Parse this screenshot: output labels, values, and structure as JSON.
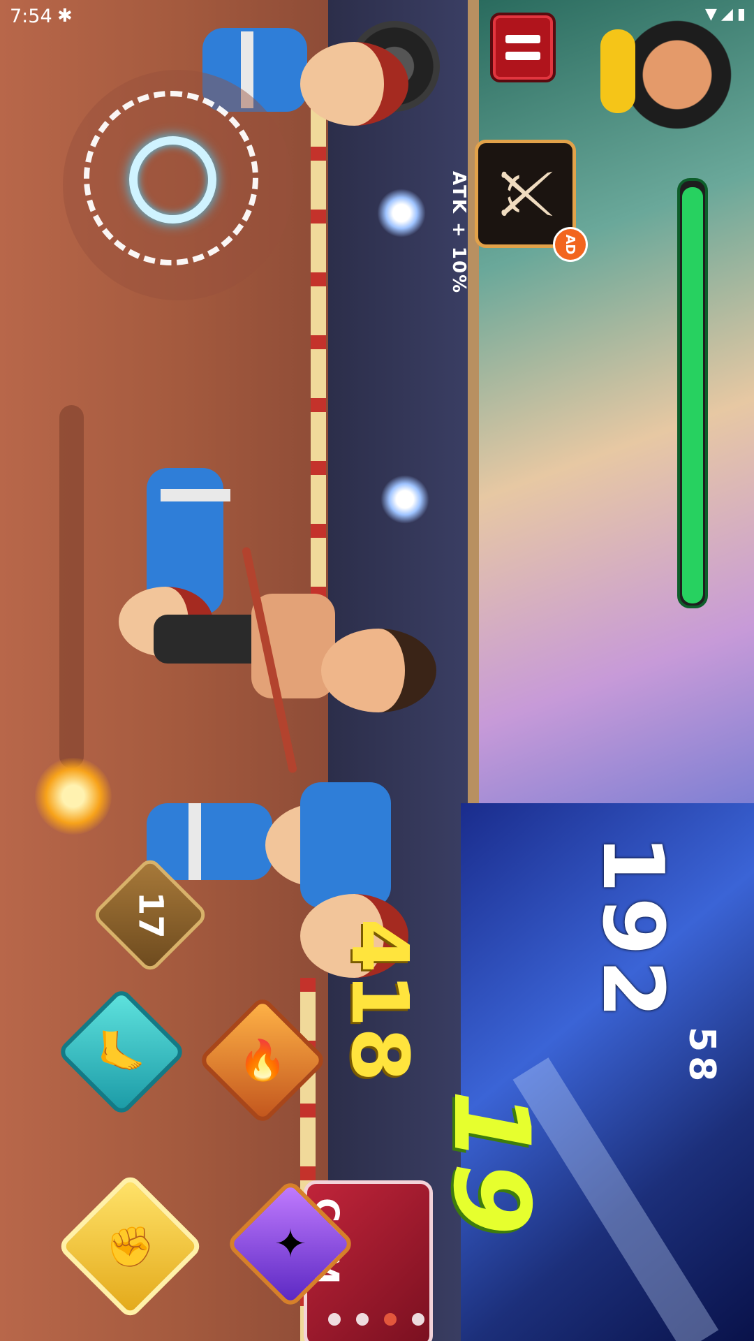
{
  "status_bar": {
    "time": "7:54",
    "notification_icon": "bug-icon",
    "icons": [
      "wifi-icon",
      "signal-icon",
      "battery-icon"
    ]
  },
  "hud": {
    "score": "192",
    "score_sub": "58",
    "hits": "19",
    "damage": "418",
    "buff_label": "ATK + 10%",
    "ad_badge": "AD",
    "skill_counter": "17",
    "health_fraction": 0.99
  },
  "combo_sign": {
    "text": "COM"
  },
  "page_indicator": {
    "count": 4,
    "active_index": 2
  },
  "colors": {
    "health": "#27d160",
    "pause": "#b0141c",
    "hits": "#e6ff2e",
    "damage": "#ffe43d"
  }
}
